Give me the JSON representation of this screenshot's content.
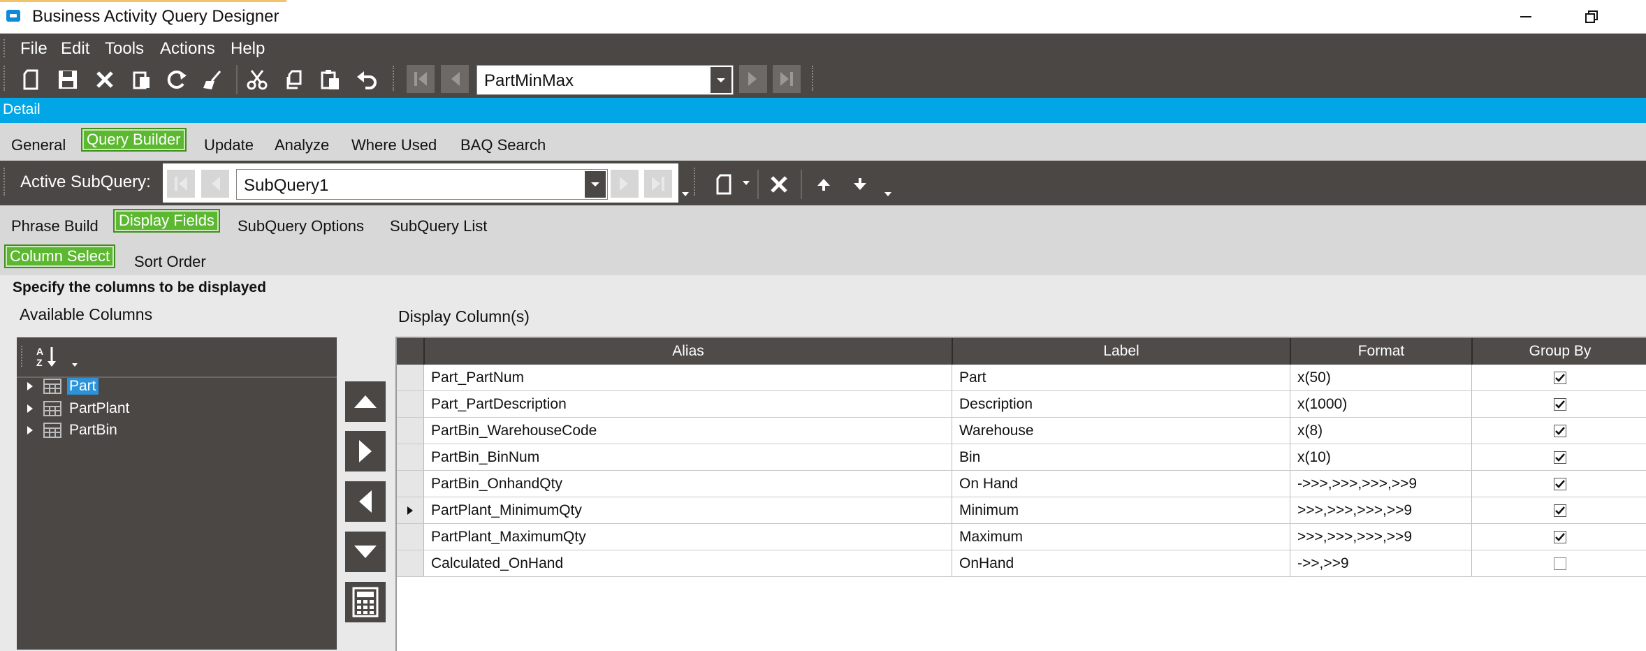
{
  "window": {
    "title": "Business Activity Query Designer"
  },
  "menu": {
    "items": [
      "File",
      "Edit",
      "Tools",
      "Actions",
      "Help"
    ]
  },
  "toolbar": {
    "query_id": "PartMinMax"
  },
  "detail_bar": {
    "label": "Detail"
  },
  "main_tabs": [
    "General",
    "Query Builder",
    "Update",
    "Analyze",
    "Where Used",
    "BAQ Search"
  ],
  "subquery_bar": {
    "label": "Active SubQuery:",
    "value": "SubQuery1"
  },
  "sub_tabs": [
    "Phrase Build",
    "Display Fields",
    "SubQuery Options",
    "SubQuery List"
  ],
  "display_tabs": [
    "Column Select",
    "Sort Order"
  ],
  "instruction": "Specify the columns to be displayed",
  "available": {
    "label": "Available Columns",
    "tree": [
      "Part",
      "PartPlant",
      "PartBin"
    ],
    "selected": "Part"
  },
  "display": {
    "label": "Display Column(s)",
    "columns": [
      "Alias",
      "Label",
      "Format",
      "Group By"
    ],
    "rows": [
      {
        "alias": "Part_PartNum",
        "label": "Part",
        "format": "x(50)",
        "group_by": true
      },
      {
        "alias": "Part_PartDescription",
        "label": "Description",
        "format": "x(1000)",
        "group_by": true
      },
      {
        "alias": "PartBin_WarehouseCode",
        "label": "Warehouse",
        "format": "x(8)",
        "group_by": true
      },
      {
        "alias": "PartBin_BinNum",
        "label": "Bin",
        "format": "x(10)",
        "group_by": true
      },
      {
        "alias": "PartBin_OnhandQty",
        "label": "On Hand",
        "format": "->>>,>>>,>>>,>>9",
        "group_by": true
      },
      {
        "alias": "PartPlant_MinimumQty",
        "label": "Minimum",
        "format": ">>>,>>>,>>>,>>9",
        "group_by": true,
        "current": true
      },
      {
        "alias": "PartPlant_MaximumQty",
        "label": "Maximum",
        "format": ">>>,>>>,>>>,>>9",
        "group_by": true
      },
      {
        "alias": "Calculated_OnHand",
        "label": "OnHand",
        "format": "->>,>>9",
        "group_by": false
      }
    ]
  },
  "colors": {
    "accent_green": "#5cb830",
    "detail_blue": "#00a6e6",
    "toolbar_dark": "#4a4745",
    "selection_blue": "#2d93d9"
  }
}
